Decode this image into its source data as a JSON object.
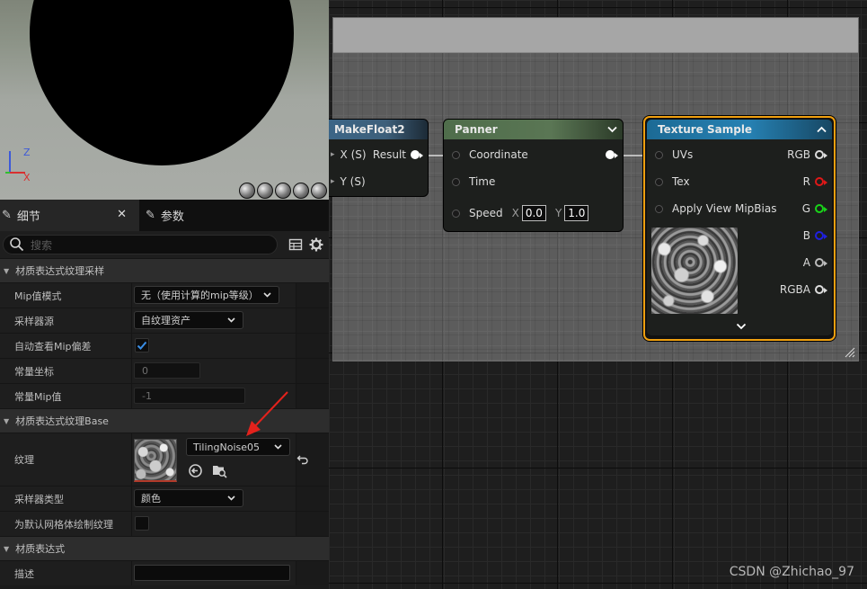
{
  "viewport": {
    "axis_labels": {
      "z": "Z",
      "x": "X"
    }
  },
  "details_panel": {
    "tabs": [
      {
        "label": "细节",
        "icon": "pencil-icon",
        "closable": true
      },
      {
        "label": "参数",
        "icon": "pencil-icon"
      }
    ],
    "search": {
      "placeholder": "搜索",
      "value": ""
    },
    "categories": {
      "sampling": {
        "title": "材质表达式纹理采样",
        "mip_value_mode_label": "Mip值模式",
        "mip_value_mode_value": "无（使用计算的mip等级）",
        "sampler_source_label": "采样器源",
        "sampler_source_value": "自纹理资产",
        "auto_view_mip_bias_label": "自动查看Mip偏差",
        "auto_view_mip_bias_checked": true,
        "const_coordinate_label": "常量坐标",
        "const_coordinate_value": "0",
        "const_mip_value_label": "常量Mip值",
        "const_mip_value_value": "-1"
      },
      "base": {
        "title": "材质表达式纹理Base",
        "texture_label": "纹理",
        "texture_value": "TilingNoise05",
        "sampler_type_label": "采样器类型",
        "sampler_type_value": "颜色",
        "is_default_meshpaint_label": "为默认网格体绘制纹理",
        "is_default_meshpaint_checked": false
      },
      "expression": {
        "title": "材质表达式",
        "desc_label": "描述",
        "desc_value": ""
      }
    }
  },
  "graph": {
    "nodes": {
      "makefloat2": {
        "title": "MakeFloat2",
        "inputs": [
          "X (S)",
          "Y (S)"
        ],
        "output": "Result",
        "color": "#3f6b8c"
      },
      "panner": {
        "title": "Panner",
        "inputs": [
          "Coordinate",
          "Time",
          "Speed"
        ],
        "speed_x_label": "X",
        "speed_x": "0.0",
        "speed_y_label": "Y",
        "speed_y": "1.0",
        "color": "#4f6a4a"
      },
      "texture_sample": {
        "title": "Texture Sample",
        "inputs": [
          "UVs",
          "Tex",
          "Apply View MipBias"
        ],
        "outputs": [
          "RGB",
          "R",
          "G",
          "B",
          "A",
          "RGBA"
        ],
        "output_colors": [
          "#dddddd",
          "#e01818",
          "#19d419",
          "#2020e0",
          "#bbbbbb",
          "#dddddd"
        ],
        "color": "#1f6f99",
        "selected_border": "#f0a010"
      }
    }
  },
  "watermark": "CSDN @Zhichao_97"
}
